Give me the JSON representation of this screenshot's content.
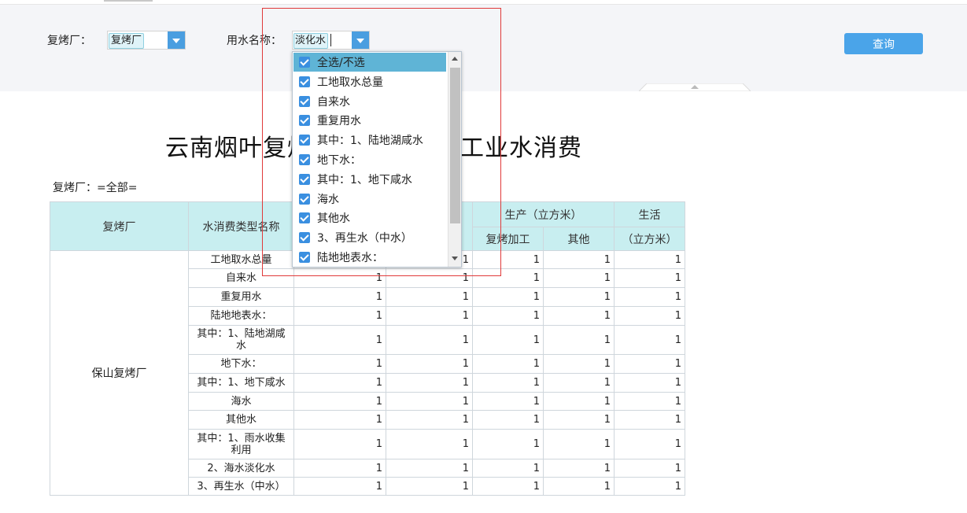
{
  "filters": {
    "factory_label": "复烤厂：",
    "factory_value": "复烤厂",
    "water_name_label": "用水名称：",
    "water_name_value": "淡化水",
    "query_button": "查询"
  },
  "dropdown": {
    "items": [
      {
        "label": "全选/不选",
        "checked": true
      },
      {
        "label": "工地取水总量",
        "checked": true
      },
      {
        "label": "自来水",
        "checked": true
      },
      {
        "label": "重复用水",
        "checked": true
      },
      {
        "label": "其中：1、陆地湖咸水",
        "checked": true
      },
      {
        "label": "地下水：",
        "checked": true
      },
      {
        "label": "其中：1、地下咸水",
        "checked": true
      },
      {
        "label": "海水",
        "checked": true
      },
      {
        "label": "其他水",
        "checked": true
      },
      {
        "label": "3、再生水（中水）",
        "checked": true
      },
      {
        "label": "陆地地表水：",
        "checked": true
      }
    ]
  },
  "report": {
    "title_left": "云南烟叶复烤",
    "title_right": "工业水消费",
    "sub_label": "复烤厂：=全部=",
    "headers": {
      "factory": "复烤厂",
      "category": "水消费类型名称",
      "production": "生产（立方米）",
      "reprocess": "复烤加工",
      "other": "其他",
      "living": "生活",
      "living_unit": "（立方米）"
    },
    "factory_name": "保山复烤厂",
    "rows": [
      {
        "name": "工地取水总量",
        "v": [
          "",
          "1",
          "1",
          "1",
          "1"
        ]
      },
      {
        "name": "自来水",
        "v": [
          "1",
          "1",
          "1",
          "1",
          "1"
        ]
      },
      {
        "name": "重复用水",
        "v": [
          "1",
          "1",
          "1",
          "1",
          "1"
        ]
      },
      {
        "name": "陆地地表水：",
        "v": [
          "1",
          "1",
          "1",
          "1",
          "1"
        ]
      },
      {
        "name": "其中：1、陆地湖咸水",
        "v": [
          "1",
          "1",
          "1",
          "1",
          "1"
        ]
      },
      {
        "name": "地下水：",
        "v": [
          "1",
          "1",
          "1",
          "1",
          "1"
        ]
      },
      {
        "name": "其中：1、地下咸水",
        "v": [
          "1",
          "1",
          "1",
          "1",
          "1"
        ]
      },
      {
        "name": "海水",
        "v": [
          "1",
          "1",
          "1",
          "1",
          "1"
        ]
      },
      {
        "name": "其他水",
        "v": [
          "1",
          "1",
          "1",
          "1",
          "1"
        ]
      },
      {
        "name": "其中：1、雨水收集利用",
        "v": [
          "1",
          "1",
          "1",
          "1",
          "1"
        ]
      },
      {
        "name": "2、海水淡化水",
        "v": [
          "1",
          "1",
          "1",
          "1",
          "1"
        ]
      },
      {
        "name": "3、再生水（中水）",
        "v": [
          "1",
          "1",
          "1",
          "1",
          "1"
        ]
      }
    ]
  },
  "colors": {
    "accent": "#4aa4e9",
    "header_bg": "#c8eef0",
    "highlight": "#e03a3a"
  }
}
